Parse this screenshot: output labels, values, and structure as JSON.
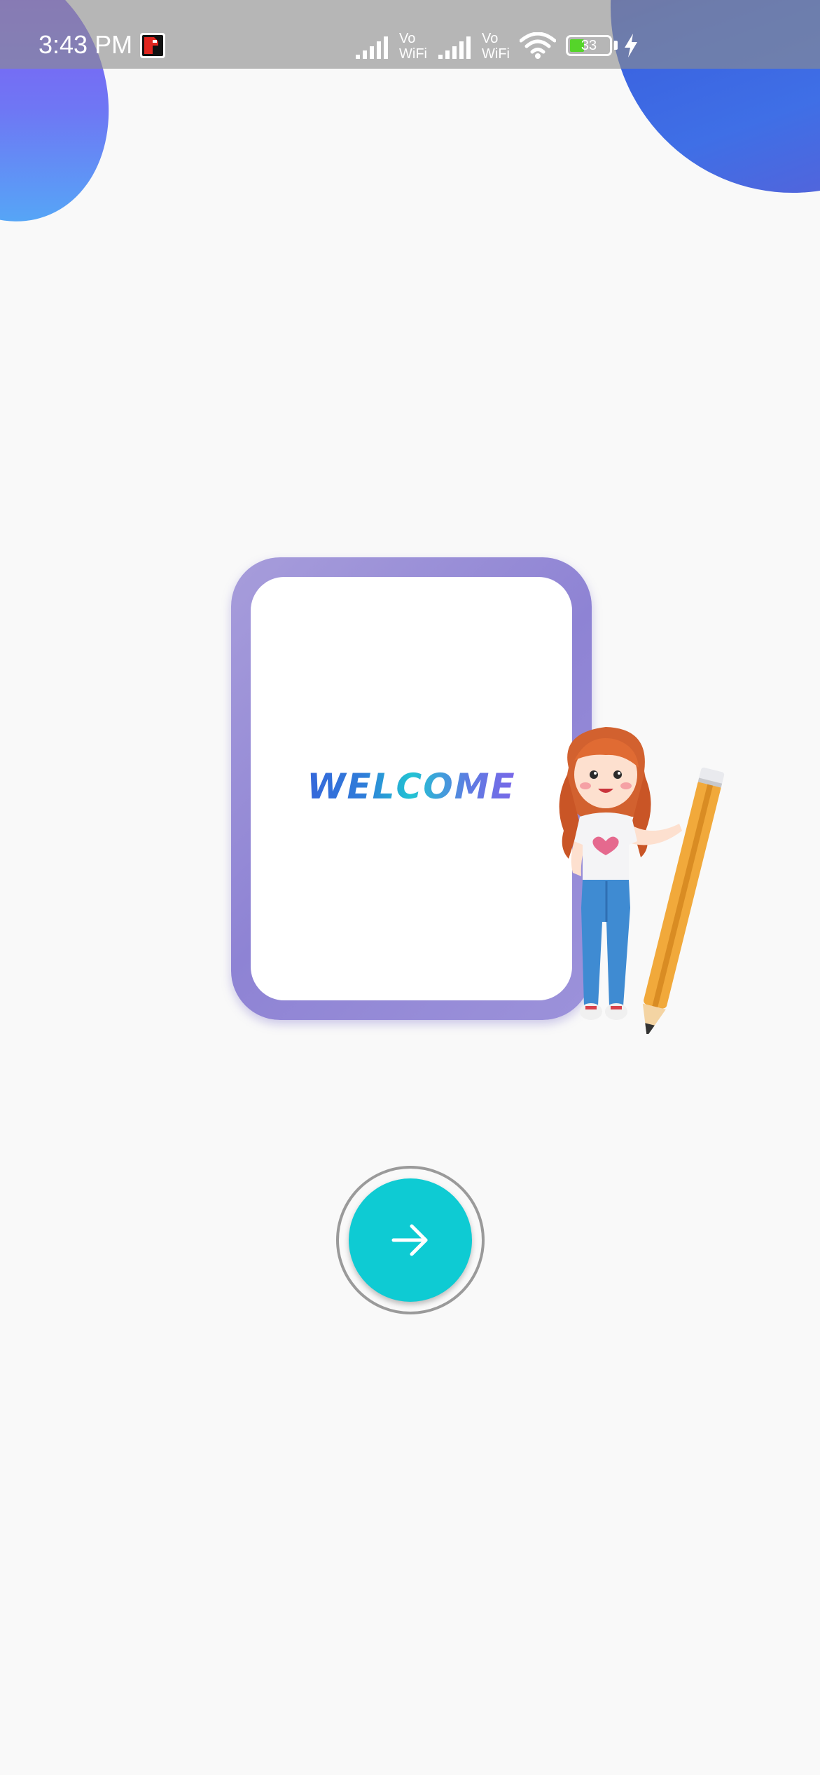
{
  "status_bar": {
    "time": "3:43 PM",
    "vowifi_1": "Vo\nWiFi",
    "vowifi_2": "Vo\nWiFi",
    "battery_level": "33",
    "icons": [
      "notification-app-icon",
      "signal-icon",
      "vowifi-icon",
      "signal-icon",
      "vowifi-icon",
      "wifi-icon",
      "battery-icon",
      "charging-bolt-icon"
    ]
  },
  "welcome": {
    "title": "WELCOME"
  },
  "next_button": {
    "icon": "arrow-right-icon"
  },
  "colors": {
    "accent_teal": "#0ecbd3",
    "frame_purple": "#968bd6",
    "blob_blue": "#3a62e0",
    "blob_purple": "#8a4ff6"
  }
}
